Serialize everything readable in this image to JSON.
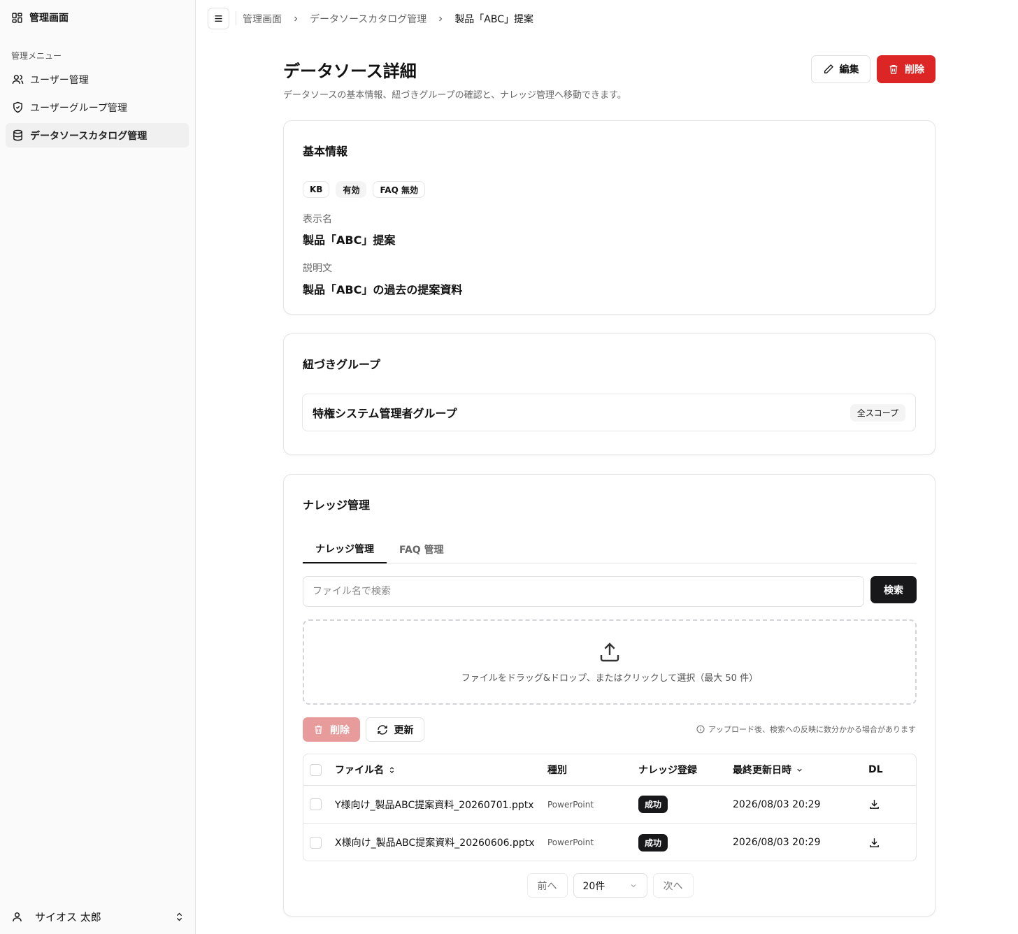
{
  "sidebar": {
    "brand": "管理画面",
    "menu_label": "管理メニュー",
    "items": [
      {
        "label": "ユーザー管理"
      },
      {
        "label": "ユーザーグループ管理"
      },
      {
        "label": "データソースカタログ管理"
      }
    ],
    "user_name": "サイオス 太郎"
  },
  "breadcrumb": [
    "管理画面",
    "データソースカタログ管理",
    "製品「ABC」提案"
  ],
  "header": {
    "title": "データソース詳細",
    "description": "データソースの基本情報、紐づきグループの確認と、ナレッジ管理へ移動できます。",
    "edit_label": "編集",
    "delete_label": "削除"
  },
  "basic_info": {
    "title": "基本情報",
    "badges": [
      "KB",
      "有効",
      "FAQ 無効"
    ],
    "display_name_label": "表示名",
    "display_name": "製品「ABC」提案",
    "description_label": "説明文",
    "description": "製品「ABC」の過去の提案資料"
  },
  "groups": {
    "title": "紐づきグループ",
    "items": [
      {
        "name": "特権システム管理者グループ",
        "scope": "全スコープ"
      }
    ]
  },
  "knowledge": {
    "title": "ナレッジ管理",
    "tabs": [
      "ナレッジ管理",
      "FAQ 管理"
    ],
    "search_placeholder": "ファイル名で検索",
    "search_button": "検索",
    "dropzone_text": "ファイルをドラッグ&ドロップ、またはクリックして選択（最大 50 件）",
    "delete_button": "削除",
    "refresh_button": "更新",
    "notice": "アップロード後、検索への反映に数分かかる場合があります",
    "columns": [
      "ファイル名",
      "種別",
      "ナレッジ登録",
      "最終更新日時",
      "DL"
    ],
    "rows": [
      {
        "file": "Y様向け_製品ABC提案資料_20260701.pptx",
        "type": "PowerPoint",
        "status": "成功",
        "updated": "2026/08/03 20:29"
      },
      {
        "file": "X様向け_製品ABC提案資料_20260606.pptx",
        "type": "PowerPoint",
        "status": "成功",
        "updated": "2026/08/03 20:29"
      }
    ],
    "pager": {
      "prev": "前へ",
      "per_page": "20件",
      "next": "次へ"
    }
  },
  "colors": {
    "danger": "#dc2626",
    "danger_disabled": "#e89b9b",
    "dark": "#18181b"
  }
}
